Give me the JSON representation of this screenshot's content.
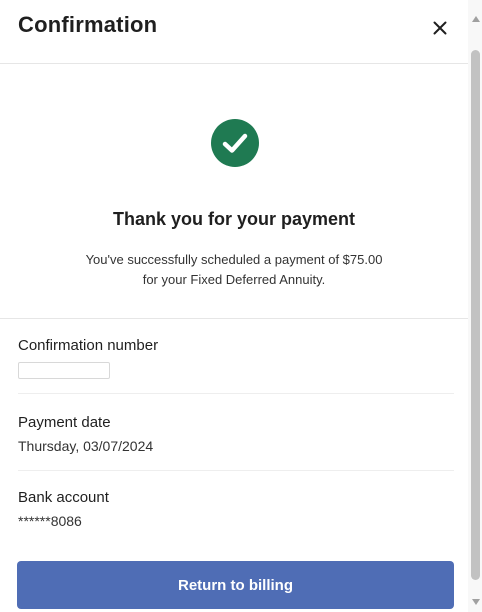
{
  "dialog": {
    "title": "Confirmation",
    "close_label": "×"
  },
  "confirmation": {
    "heading": "Thank you for your payment",
    "message_line1": "You've successfully scheduled a payment of $75.00",
    "message_line2": "for your Fixed Deferred Annuity."
  },
  "details": {
    "confirmation_number": {
      "label": "Confirmation number"
    },
    "payment_date": {
      "label": "Payment date",
      "value": "Thursday, 03/07/2024"
    },
    "bank_account": {
      "label": "Bank account",
      "value": "******8086"
    }
  },
  "actions": {
    "return_label": "Return to billing"
  },
  "colors": {
    "success_green": "#1f7a52",
    "primary_button": "#4f6db5"
  },
  "icons": {
    "success": "check-circle-icon",
    "close": "close-icon"
  }
}
